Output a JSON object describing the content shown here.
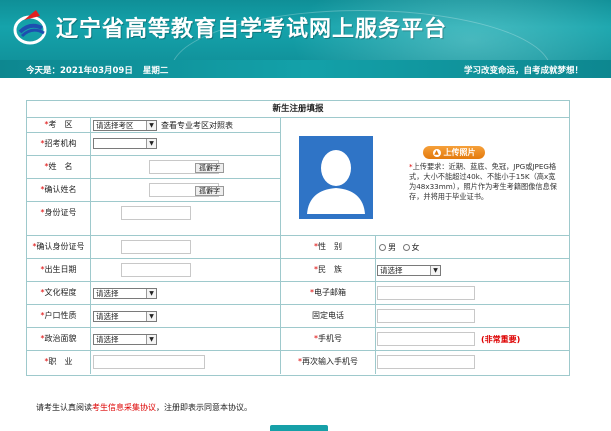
{
  "header": {
    "title": "辽宁省高等教育自学考试网上服务平台",
    "date_label": "今天是：2021年03月09日",
    "weekday": "星期二",
    "slogan": "学习改变命运，自考成就梦想！"
  },
  "form": {
    "title": "新生注册填报",
    "exam_area": {
      "label": "考　区",
      "select_value": "请选择考区",
      "link": "查看专业考区对照表"
    },
    "agency": {
      "label": "招考机构",
      "select_value": ""
    },
    "name": {
      "label": "姓　名",
      "button": "孤僻字"
    },
    "confirm_name": {
      "label": "确认姓名",
      "button": "孤僻字"
    },
    "id_number": {
      "label": "身份证号"
    },
    "confirm_id": {
      "label": "确认身份证号"
    },
    "birth_date": {
      "label": "出生日期"
    },
    "education": {
      "label": "文化程度",
      "select_value": "请选择"
    },
    "household": {
      "label": "户口性质",
      "select_value": "请选择"
    },
    "political": {
      "label": "政治面貌",
      "select_value": "请选择"
    },
    "occupation": {
      "label": "职　业"
    },
    "gender": {
      "label": "性　别",
      "male": "男",
      "female": "女"
    },
    "ethnicity": {
      "label": "民　族",
      "select_value": "请选择"
    },
    "email": {
      "label": "电子邮箱"
    },
    "phone": {
      "label": "固定电话"
    },
    "mobile": {
      "label": "手机号",
      "note": "(非常重要)"
    },
    "mobile_confirm": {
      "label": "再次输入手机号"
    },
    "photo": {
      "placeholder": "暂无照片",
      "upload_label": "上传照片",
      "requirements": "上传要求：近期、蓝底、免冠，JPG或JPEG格式，大小不能超过40k、不能小于15K（高x宽为48x33mm），照片作为考生考籍图像信息保存，并将用于毕业证书。"
    }
  },
  "agreement": {
    "prefix": "请考生认真阅读",
    "link": "考生信息采集协议",
    "suffix": "，注册即表示同意本协议。"
  },
  "colors": {
    "banner": "#13a1a9",
    "accent_red": "#dd0000",
    "photo_bg": "#2f74c6",
    "upload_btn": "#f08c1e"
  }
}
